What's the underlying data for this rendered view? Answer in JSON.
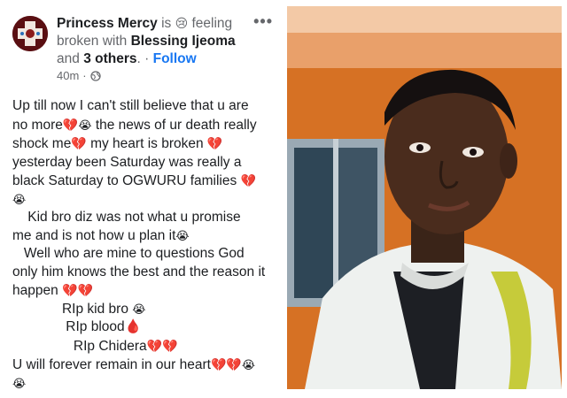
{
  "post": {
    "author": "Princess Mercy",
    "header_is": "is",
    "emoji_feeling": "😢",
    "feeling": "feeling broken with",
    "tagged": "Blessing Ijeoma",
    "and_label": "and",
    "others": "3 others",
    "dot": "·",
    "follow_label": "Follow",
    "timestamp": "40m",
    "audience_icon": "globe-icon",
    "more_icon": "more-options-icon",
    "lines": [
      "Up till now I can't still believe that u are",
      "no more",
      "the news of ur death really",
      "shock me",
      "my heart is broken",
      "yesterday been Saturday was really a",
      "black Saturday to OGWURU families",
      "Kid bro diz was not what u promise",
      "me and is not how u plan it",
      "Well who are mine to questions God",
      "only him knows the best and the reason it",
      "happen",
      "RIp kid bro",
      "RIp blood",
      "RIp Chidera",
      "U will forever remain in our heart"
    ],
    "emoji_broken_heart": "💔",
    "emoji_crying": "😭",
    "emoji_blood": "🩸"
  },
  "photo": {
    "subject": "selfie of young man in white jacket against orange wall"
  },
  "colors": {
    "link": "#1877f2",
    "text": "#1c1e21",
    "muted": "#65676b",
    "heart": "#d92a3a",
    "wall_orange": "#d97a2c"
  }
}
